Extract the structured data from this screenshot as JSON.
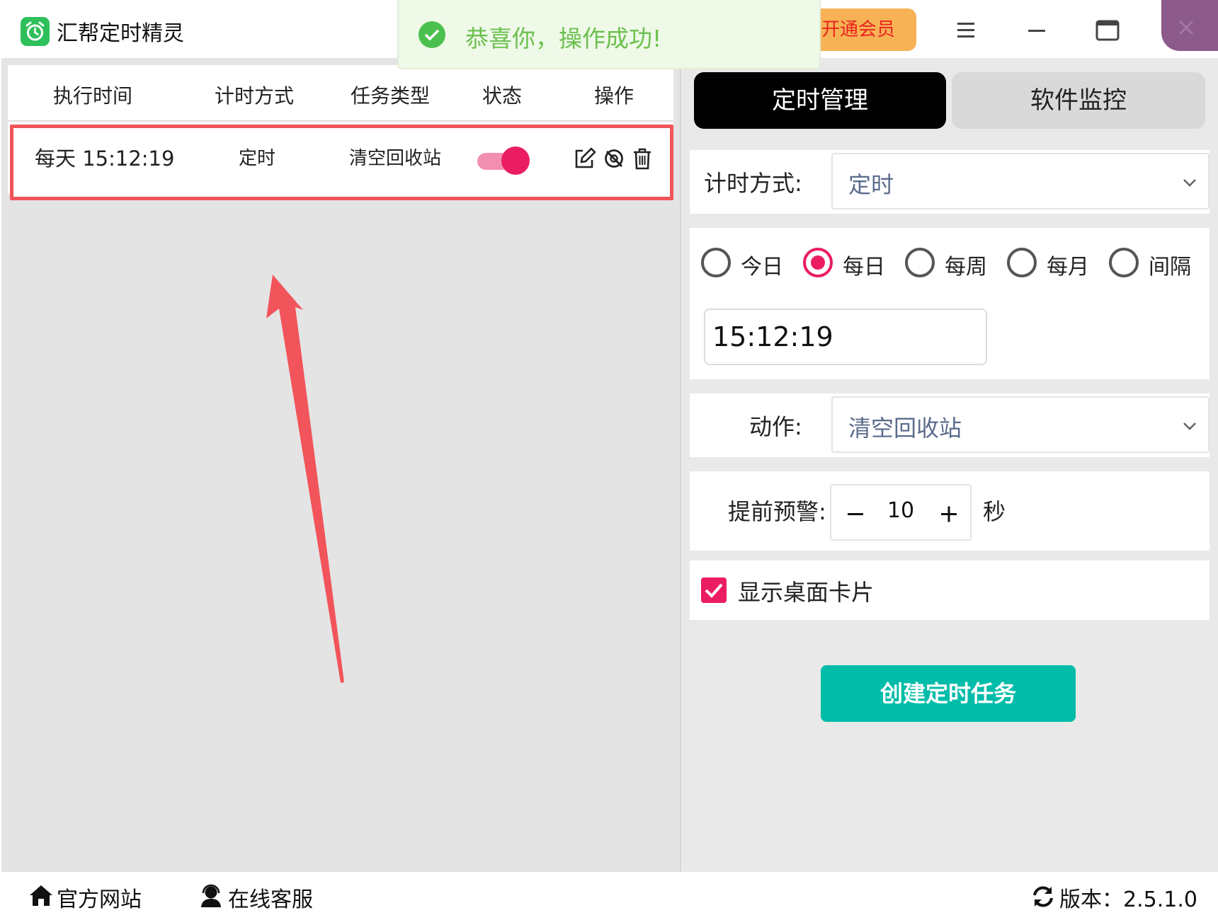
{
  "app": {
    "title": "汇帮定时精灵",
    "vip_label": "开通会员",
    "logo_icon": "alarm-clock-icon"
  },
  "window_controls": [
    "menu-icon",
    "minimize-icon",
    "maximize-icon",
    "close-icon"
  ],
  "toast": {
    "message": "恭喜你，操作成功!",
    "icon": "check-circle-icon",
    "color": "#6cc04e"
  },
  "task_table": {
    "columns": [
      "执行时间",
      "计时方式",
      "任务类型",
      "状态",
      "操作"
    ],
    "rows": [
      {
        "time": "每天 15:12:19",
        "mode": "定时",
        "type": "清空回收站",
        "enabled": true,
        "actions": [
          "edit-icon",
          "disable-icon",
          "trash-icon"
        ]
      }
    ],
    "highlight_color": "#f2545b"
  },
  "tabs": [
    {
      "label": "定时管理",
      "active": true
    },
    {
      "label": "软件监控",
      "active": false
    }
  ],
  "form": {
    "timing_label": "计时方式:",
    "timing_value": "定时",
    "frequency_options": [
      {
        "label": "今日",
        "checked": false
      },
      {
        "label": "每日",
        "checked": true
      },
      {
        "label": "每周",
        "checked": false
      },
      {
        "label": "每月",
        "checked": false
      },
      {
        "label": "间隔",
        "checked": false
      }
    ],
    "time_value": "15:12:19",
    "action_label": "动作:",
    "action_value": "清空回收站",
    "warning_label": "提前预警:",
    "warning_value": "10",
    "warning_unit": "秒",
    "show_card_label": "显示桌面卡片",
    "show_card_checked": true,
    "submit_label": "创建定时任务"
  },
  "footer": {
    "website_label": "官方网站",
    "support_label": "在线客服",
    "version_label": "版本：2.5.1.0"
  },
  "colors": {
    "accent_pink": "#ea1d63",
    "submit_teal": "#01bca9",
    "vip_orange": "#f7b255",
    "close_purple": "#8d5a8c"
  }
}
